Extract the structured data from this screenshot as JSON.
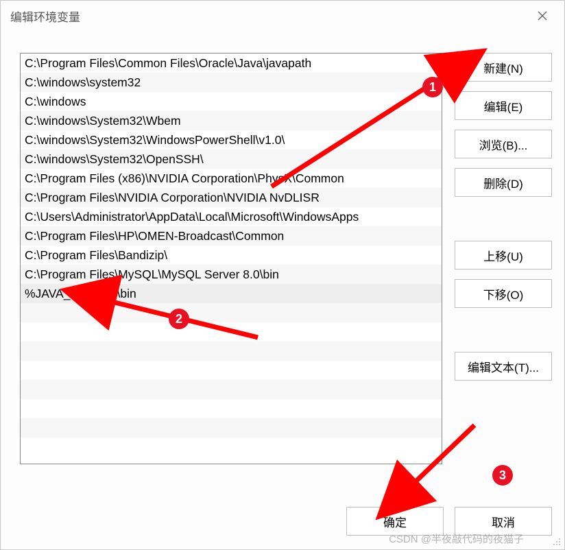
{
  "titlebar": {
    "title": "编辑环境变量"
  },
  "paths": [
    "C:\\Program Files\\Common Files\\Oracle\\Java\\javapath",
    "C:\\windows\\system32",
    "C:\\windows",
    "C:\\windows\\System32\\Wbem",
    "C:\\windows\\System32\\WindowsPowerShell\\v1.0\\",
    "C:\\windows\\System32\\OpenSSH\\",
    "C:\\Program Files (x86)\\NVIDIA Corporation\\PhysX\\Common",
    "C:\\Program Files\\NVIDIA Corporation\\NVIDIA NvDLISR",
    "C:\\Users\\Administrator\\AppData\\Local\\Microsoft\\WindowsApps",
    "C:\\Program Files\\HP\\OMEN-Broadcast\\Common",
    "C:\\Program Files\\Bandizip\\",
    "C:\\Program Files\\MySQL\\MySQL Server 8.0\\bin",
    "%JAVA_HOME%\\bin"
  ],
  "selected_index": 12,
  "buttons": {
    "new": "新建(N)",
    "edit": "编辑(E)",
    "browse": "浏览(B)...",
    "delete": "删除(D)",
    "move_up": "上移(U)",
    "move_down": "下移(O)",
    "edit_text": "编辑文本(T)...",
    "ok": "确定",
    "cancel": "取消"
  },
  "annotations": {
    "badge1": "1",
    "badge2": "2",
    "badge3": "3",
    "arrow_color": "#ff0000"
  },
  "watermark": "CSDN @半夜敲代码的夜猫子"
}
